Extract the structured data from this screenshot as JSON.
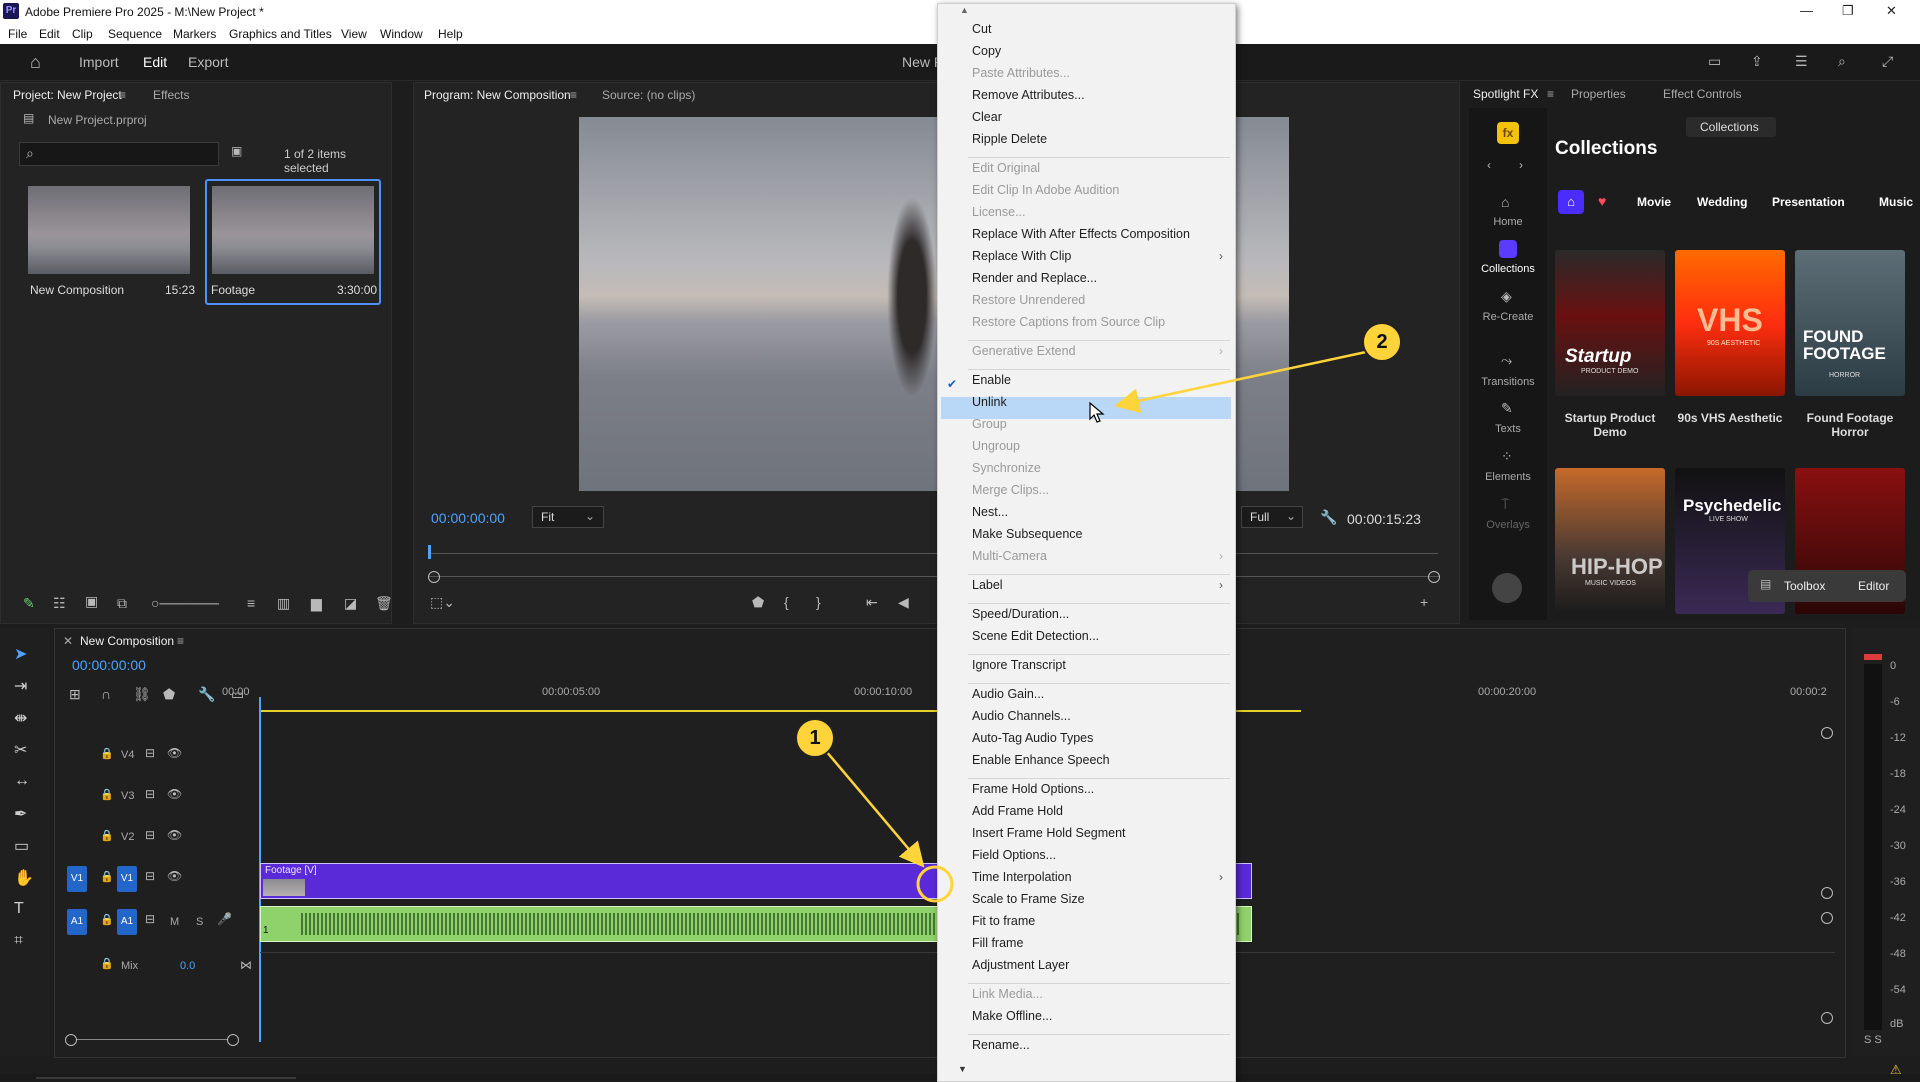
{
  "window": {
    "title": "Adobe Premiere Pro 2025 - M:\\New Project *",
    "app_badge": "Pr"
  },
  "menu": [
    "File",
    "Edit",
    "Clip",
    "Sequence",
    "Markers",
    "Graphics and Titles",
    "View",
    "Window",
    "Help"
  ],
  "header": {
    "tabs": [
      "Import",
      "Edit",
      "Export"
    ],
    "active": "Edit",
    "project_name": "New P"
  },
  "project": {
    "tab_project": "Project: New Project",
    "tab_effects": "Effects",
    "file": "New Project.prproj",
    "search_placeholder": "",
    "selection": "1 of 2 items selected",
    "items": [
      {
        "name": "New Composition",
        "duration": "15:23"
      },
      {
        "name": "Footage",
        "duration": "3:30:00"
      }
    ]
  },
  "program": {
    "tab_program": "Program: New Composition",
    "tab_source": "Source: (no clips)",
    "timecode": "00:00:00:00",
    "fit": "Fit",
    "quality": "Full",
    "duration": "00:00:15:23"
  },
  "context_menu": {
    "items": [
      {
        "label": "Cut",
        "disabled": false
      },
      {
        "label": "Copy",
        "disabled": false
      },
      {
        "label": "Paste Attributes...",
        "disabled": true
      },
      {
        "label": "Remove Attributes...",
        "disabled": false
      },
      {
        "label": "Clear",
        "disabled": false
      },
      {
        "label": "Ripple Delete",
        "disabled": false
      },
      {
        "label": "Edit Original",
        "disabled": true
      },
      {
        "label": "Edit Clip In Adobe Audition",
        "disabled": true
      },
      {
        "label": "License...",
        "disabled": true
      },
      {
        "label": "Replace With After Effects Composition",
        "disabled": false
      },
      {
        "label": "Replace With Clip",
        "disabled": false
      },
      {
        "label": "Render and Replace...",
        "disabled": false
      },
      {
        "label": "Restore Unrendered",
        "disabled": true
      },
      {
        "label": "Restore Captions from Source Clip",
        "disabled": true
      },
      {
        "label": "Generative Extend",
        "disabled": true
      },
      {
        "label": "Enable",
        "disabled": false
      },
      {
        "label": "Unlink",
        "disabled": false
      },
      {
        "label": "Group",
        "disabled": true
      },
      {
        "label": "Ungroup",
        "disabled": true
      },
      {
        "label": "Synchronize",
        "disabled": true
      },
      {
        "label": "Merge Clips...",
        "disabled": true
      },
      {
        "label": "Nest...",
        "disabled": false
      },
      {
        "label": "Make Subsequence",
        "disabled": false
      },
      {
        "label": "Multi-Camera",
        "disabled": true
      },
      {
        "label": "Label",
        "disabled": false
      },
      {
        "label": "Speed/Duration...",
        "disabled": false
      },
      {
        "label": "Scene Edit Detection...",
        "disabled": false
      },
      {
        "label": "Ignore Transcript",
        "disabled": false
      },
      {
        "label": "Audio Gain...",
        "disabled": false
      },
      {
        "label": "Audio Channels...",
        "disabled": false
      },
      {
        "label": "Auto-Tag Audio Types",
        "disabled": false
      },
      {
        "label": "Enable Enhance Speech",
        "disabled": false
      },
      {
        "label": "Frame Hold Options...",
        "disabled": false
      },
      {
        "label": "Add Frame Hold",
        "disabled": false
      },
      {
        "label": "Insert Frame Hold Segment",
        "disabled": false
      },
      {
        "label": "Field Options...",
        "disabled": false
      },
      {
        "label": "Time Interpolation",
        "disabled": false
      },
      {
        "label": "Scale to Frame Size",
        "disabled": false
      },
      {
        "label": "Fit to frame",
        "disabled": false
      },
      {
        "label": "Fill frame",
        "disabled": false
      },
      {
        "label": "Adjustment Layer",
        "disabled": false
      },
      {
        "label": "Link Media...",
        "disabled": true
      },
      {
        "label": "Make Offline...",
        "disabled": false
      },
      {
        "label": "Rename...",
        "disabled": false
      }
    ],
    "highlighted": "Unlink",
    "checked": "Enable"
  },
  "spotlight": {
    "tabs": [
      "Spotlight FX",
      "Properties",
      "Effect Controls"
    ],
    "heading": "Collections",
    "collections_button": "Collections",
    "sidebar": [
      "Home",
      "Collections",
      "Re-Create",
      "Transitions",
      "Texts",
      "Elements",
      "Overlays"
    ],
    "categories": [
      "Movie",
      "Wedding",
      "Presentation",
      "Music"
    ],
    "cards": [
      "Startup Product Demo",
      "90s VHS Aesthetic",
      "Found Footage Horror"
    ],
    "card_art": [
      "Startup",
      "PRODUCT DEMO",
      "VHS",
      "90S AESTHETIC",
      "FOUND FOOTAGE",
      "HORROR",
      "HIP-HOP",
      "MUSIC VIDEOS",
      "Psychedelic",
      "LIVE SHOW"
    ],
    "toolbox": "Toolbox",
    "editor": "Editor"
  },
  "timeline": {
    "tab": "New Composition",
    "timecode": "00:00:00:00",
    "ruler": [
      "00:00",
      "00:00:05:00",
      "00:00:10:00",
      "00:00:20:00",
      "00:00:2"
    ],
    "tracks": [
      "V4",
      "V3",
      "V2",
      "V1",
      "A1"
    ],
    "mix_label": "Mix",
    "mix_value": "0.0",
    "clip_label": "Footage [V]",
    "audio_clip_num": "1"
  },
  "meter": {
    "scale": [
      "0",
      "-6",
      "-12",
      "-18",
      "-24",
      "-30",
      "-36",
      "-42",
      "-48",
      "-54"
    ],
    "unit": "dB",
    "solo": "S S"
  },
  "annotations": [
    "1",
    "2"
  ],
  "colors": {
    "accent_blue": "#2366c9",
    "clip_purple": "#5b2ad8",
    "audio_green": "#8fd16a",
    "highlight": "#b9d8f7",
    "annotation": "#ffd33a"
  }
}
